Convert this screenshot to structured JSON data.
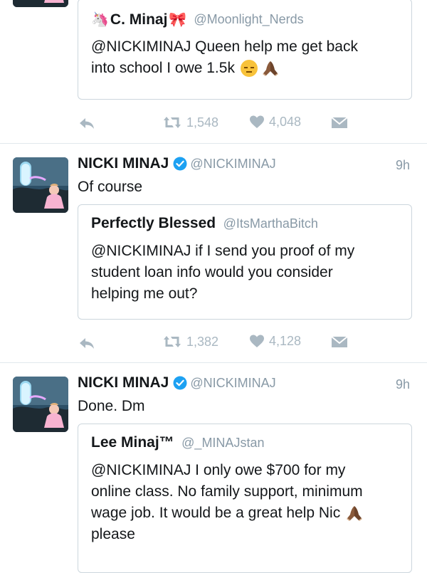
{
  "tweet0": {
    "quote": {
      "name": "C. Minaj",
      "handle": "@Moonlight_Nerds",
      "text_line1": "@NICKIMINAJ Queen help me get back",
      "text_line2": "into school I owe 1.5k"
    },
    "actions": {
      "retweets": "1,548",
      "likes": "4,048"
    }
  },
  "tweet1": {
    "name": "NICKI MINAJ",
    "handle": "@NICKIMINAJ",
    "time": "9h",
    "text": "Of course",
    "quote": {
      "name": "Perfectly Blessed",
      "handle": "@ItsMarthaBitch",
      "lines": [
        "@NICKIMINAJ if I send you proof of my",
        "student loan info would you consider",
        "helping me out?"
      ]
    },
    "actions": {
      "retweets": "1,382",
      "likes": "4,128"
    }
  },
  "tweet2": {
    "name": "NICKI MINAJ",
    "handle": "@NICKIMINAJ",
    "time": "9h",
    "text": "Done. Dm",
    "quote": {
      "name": "Lee Minaj™",
      "handle": "@_MINAJstan",
      "lines": [
        "@NICKIMINAJ I only owe $700 for my",
        "online class. No family support, minimum",
        "wage job. It would be a great help Nic",
        "please"
      ]
    }
  },
  "colors": {
    "action_gray": "#aab8c2",
    "verified_blue": "#1da1f2",
    "divider": "#e1e8ed"
  },
  "icons": [
    "reply-icon",
    "retweet-icon",
    "like-icon",
    "message-icon",
    "verified-icon",
    "unicorn-emoji",
    "bow-emoji",
    "pensive-emoji",
    "praying-hands-emoji"
  ]
}
